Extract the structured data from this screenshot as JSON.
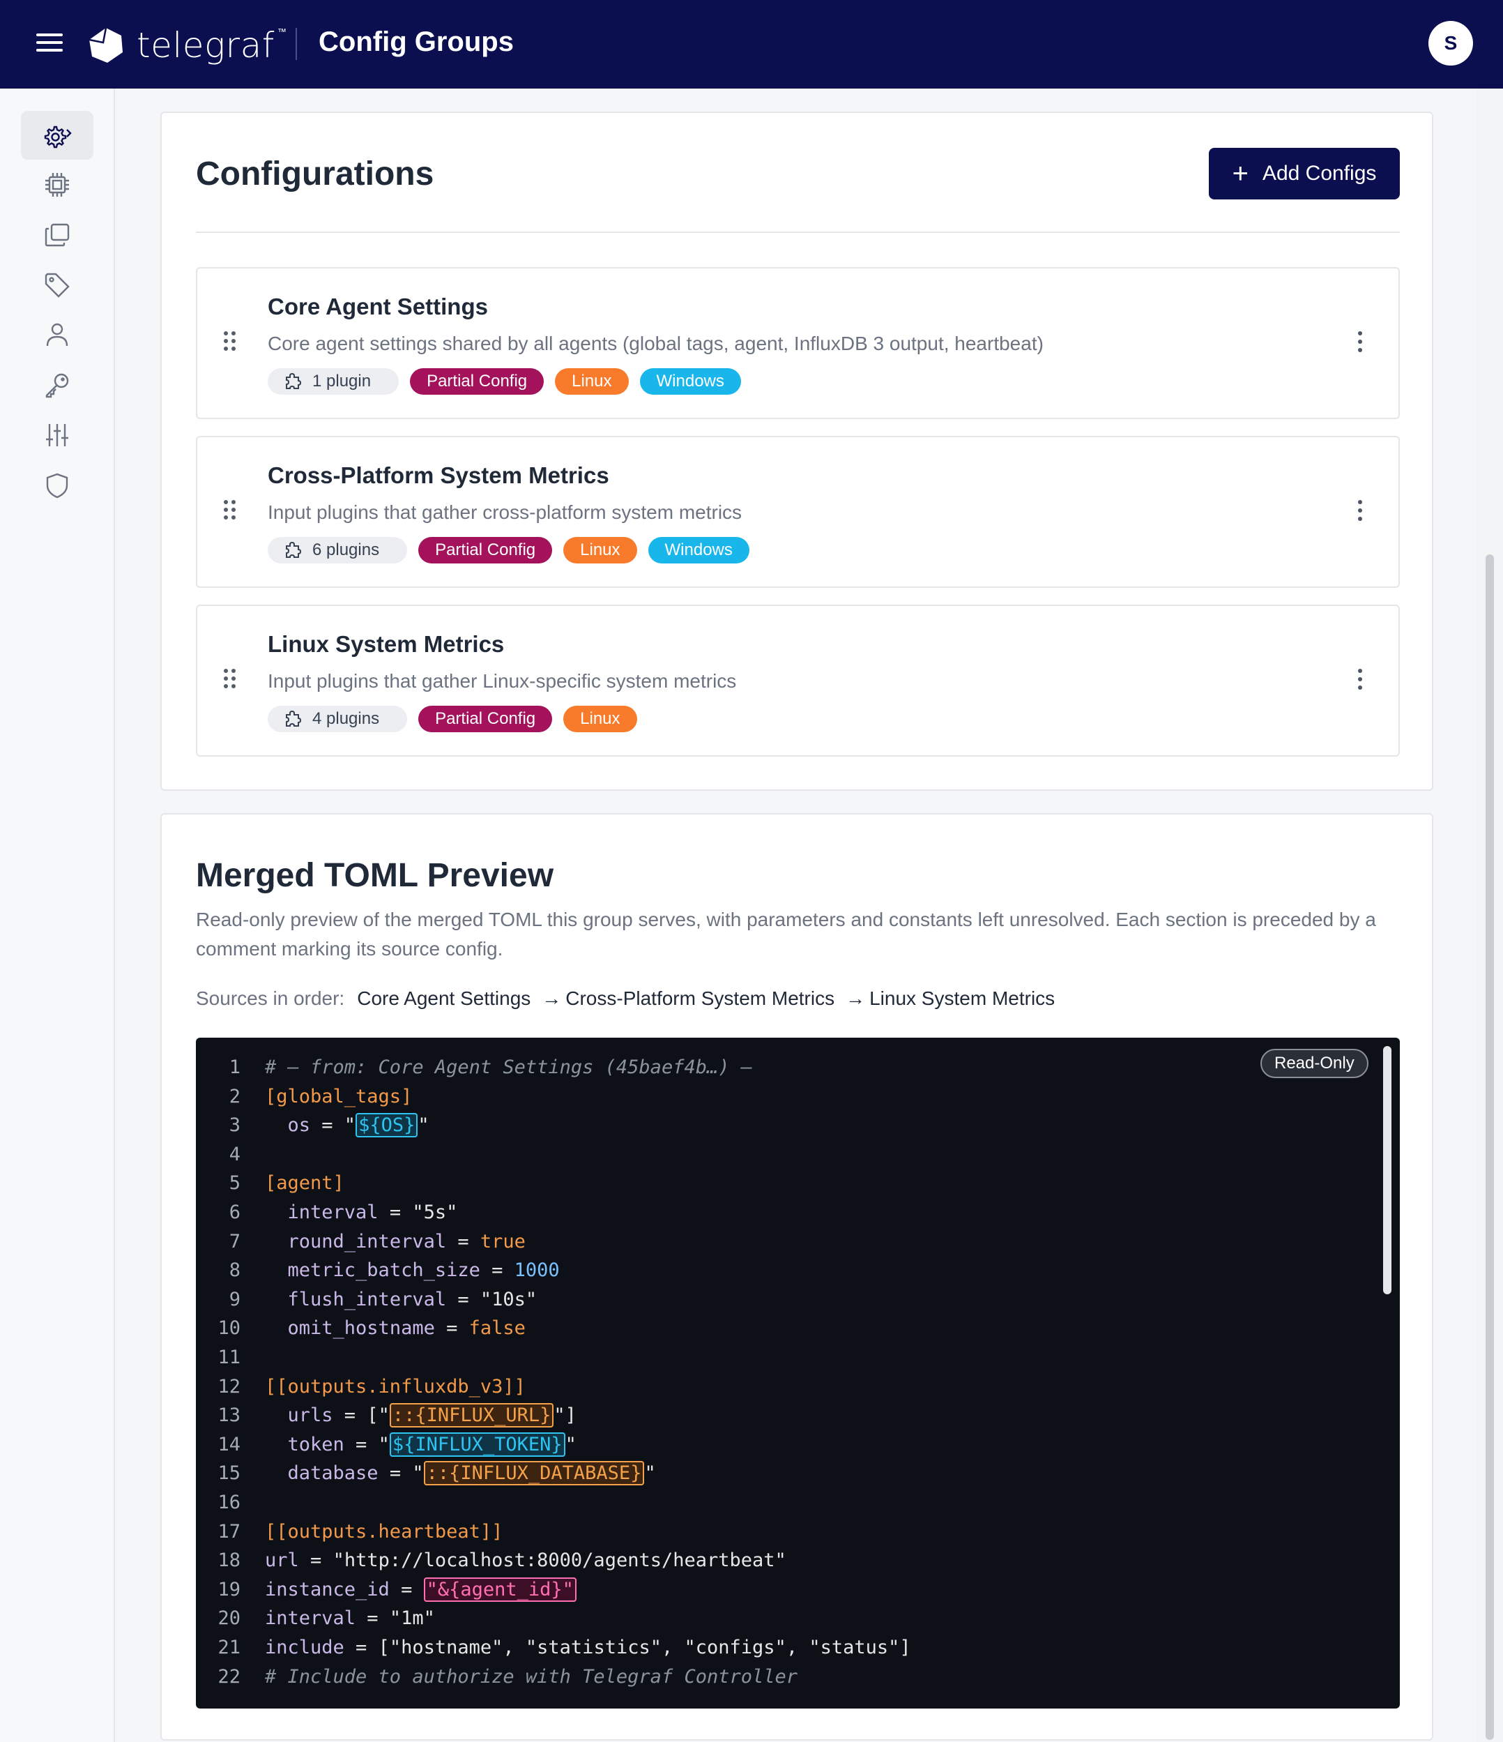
{
  "header": {
    "brand": "telegraf",
    "trademark": "™",
    "page_title": "Config Groups",
    "avatar_initial": "S"
  },
  "sidebar": {
    "items": [
      {
        "icon": "gear-icon",
        "active": true
      },
      {
        "icon": "chip-icon",
        "active": false
      },
      {
        "icon": "copy-icon",
        "active": false
      },
      {
        "icon": "tag-icon",
        "active": false
      },
      {
        "icon": "user-icon",
        "active": false
      },
      {
        "icon": "key-icon",
        "active": false
      },
      {
        "icon": "sliders-icon",
        "active": false
      },
      {
        "icon": "shield-icon",
        "active": false
      }
    ]
  },
  "configurations": {
    "title": "Configurations",
    "add_button": "Add Configs",
    "items": [
      {
        "name": "Core Agent Settings",
        "description": "Core agent settings shared by all agents (global tags, agent, InfluxDB 3 output, heartbeat)",
        "plugins": "1 plugin",
        "tags": [
          "Partial Config",
          "Linux",
          "Windows"
        ]
      },
      {
        "name": "Cross-Platform System Metrics",
        "description": "Input plugins that gather cross-platform system metrics",
        "plugins": "6 plugins",
        "tags": [
          "Partial Config",
          "Linux",
          "Windows"
        ]
      },
      {
        "name": "Linux System Metrics",
        "description": "Input plugins that gather Linux-specific system metrics",
        "plugins": "4 plugins",
        "tags": [
          "Partial Config",
          "Linux"
        ]
      }
    ]
  },
  "toml": {
    "title": "Merged TOML Preview",
    "description": "Read-only preview of the merged TOML this group serves, with parameters and constants left unresolved. Each section is preceded by a comment marking its source config.",
    "sources_label": "Sources in order:",
    "sources": [
      "Core Agent Settings",
      "Cross-Platform System Metrics",
      "Linux System Metrics"
    ],
    "readonly_badge": "Read-Only",
    "line_numbers": [
      "1",
      "2",
      "3",
      "4",
      "5",
      "6",
      "7",
      "8",
      "9",
      "10",
      "11",
      "12",
      "13",
      "14",
      "15",
      "16",
      "17",
      "18",
      "19",
      "20",
      "21",
      "22"
    ]
  },
  "colors": {
    "topbar": "#0b0e4f",
    "partial_config": "#a3125a",
    "linux": "#f77b2a",
    "windows": "#18b6ea",
    "code_bg": "#0d1117"
  }
}
